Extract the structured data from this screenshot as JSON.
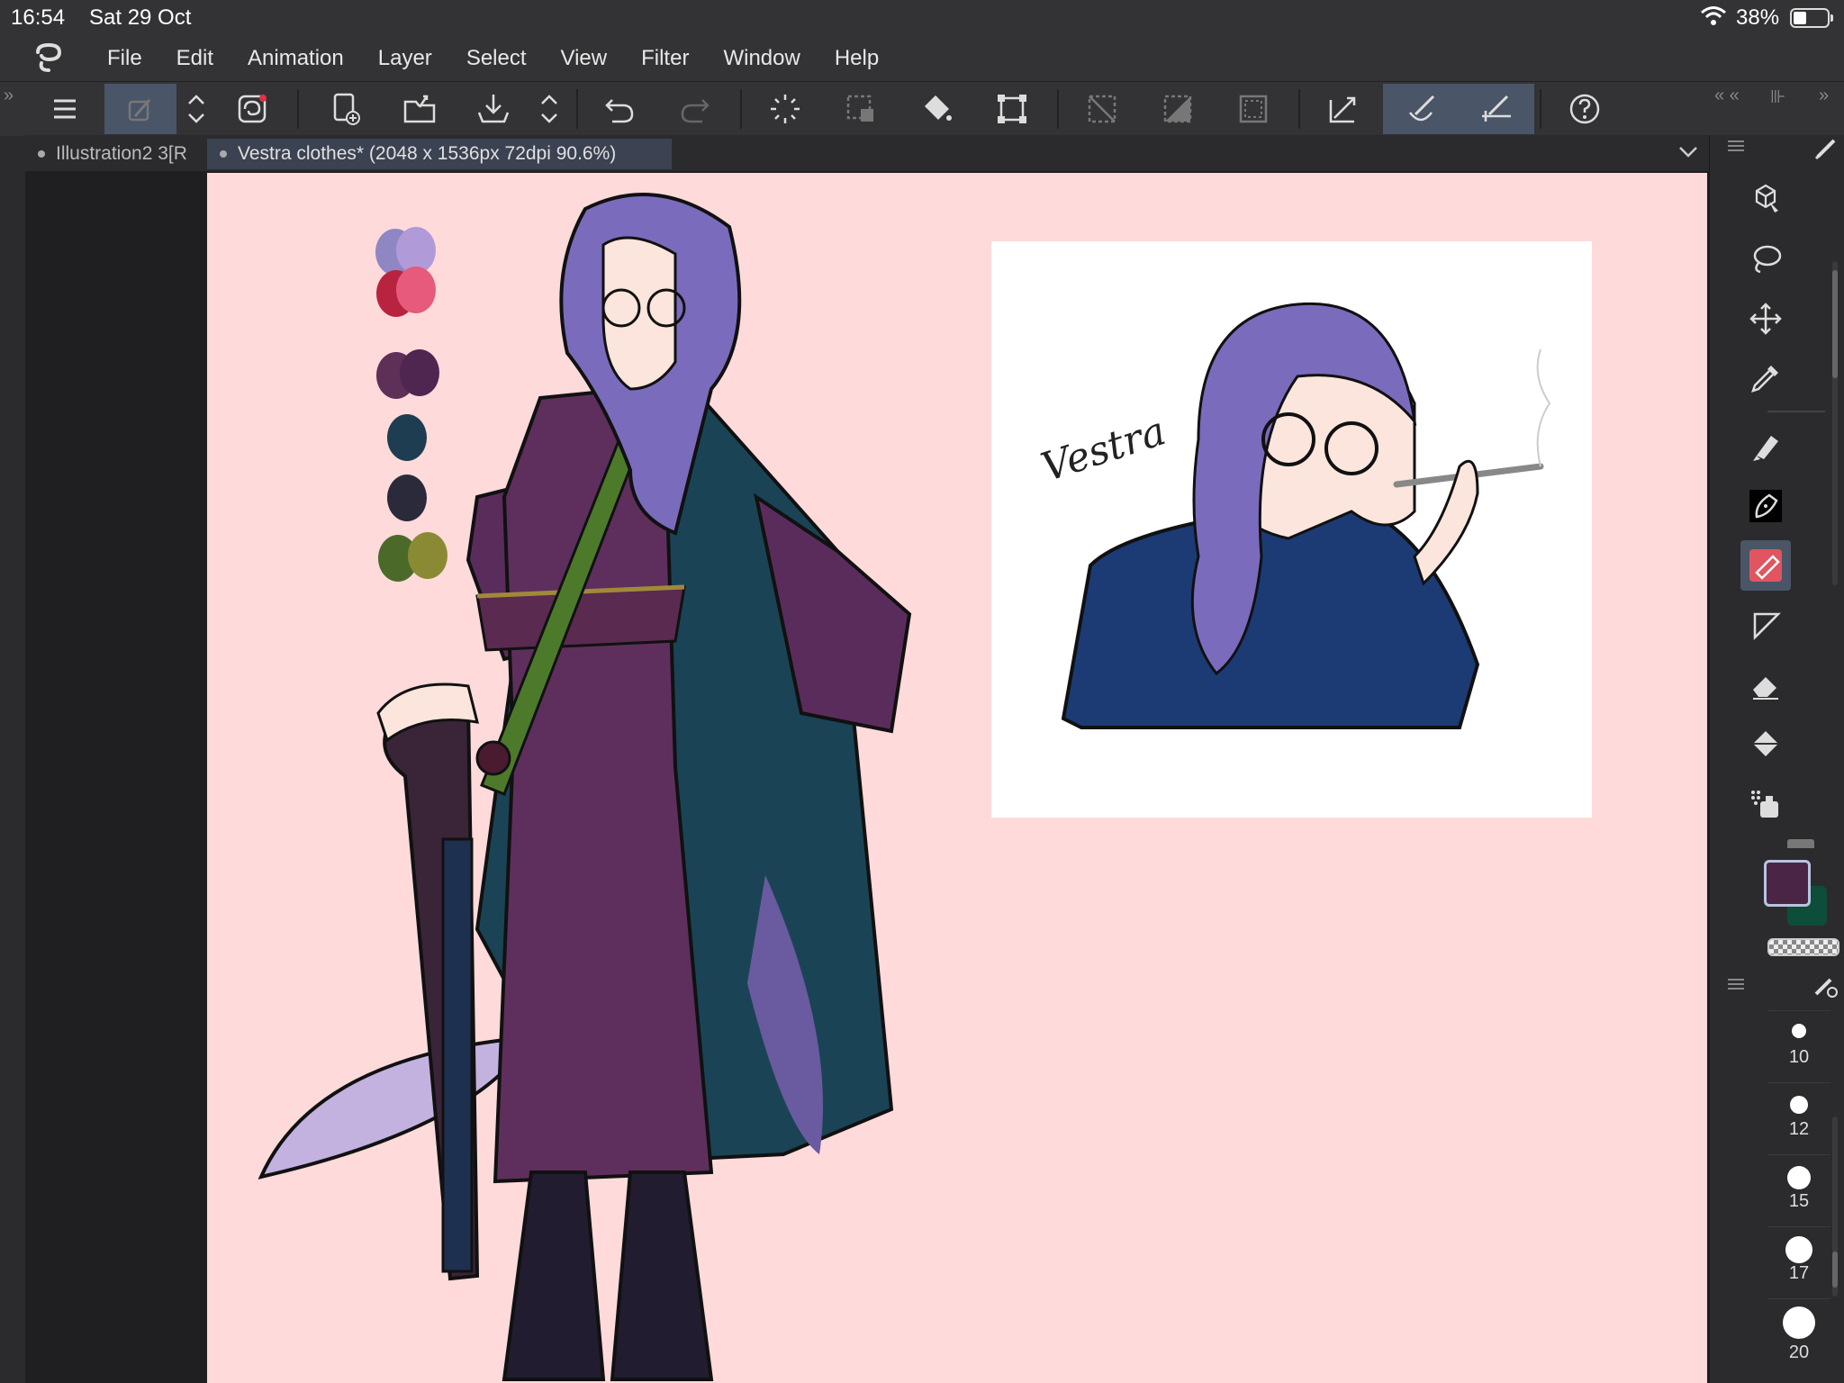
{
  "status_bar": {
    "time": "16:54",
    "date": "Sat 29 Oct",
    "battery_text": "38%"
  },
  "menu": {
    "items": [
      "File",
      "Edit",
      "Animation",
      "Layer",
      "Select",
      "View",
      "Filter",
      "Window",
      "Help"
    ]
  },
  "toolbar": {
    "icons": [
      "hamburger-menu-icon",
      "quick-access-icon",
      "up-down-chevron-icon",
      "app-logo-icon",
      "new-canvas-icon",
      "open-folder-icon",
      "save-icon",
      "up-down-chevron-icon",
      "undo-icon",
      "redo-icon",
      "auto-select-icon",
      "transform-select-icon",
      "fill-icon",
      "transform-icon",
      "deselect-icon",
      "invert-selection-icon",
      "selection-border-icon",
      "select-layer-icon",
      "stabilizer-icon",
      "snap-icon",
      "help-icon"
    ]
  },
  "tabs": [
    {
      "label": "Illustration2 3[R"
    },
    {
      "label": "Vestra clothes* (2048 x 1536px 72dpi 90.6%)"
    }
  ],
  "artwork": {
    "signature": "Vestra",
    "palette": [
      "#8f86c4",
      "#b19ad8",
      "#b8243f",
      "#e65a7b",
      "#5e2f57",
      "#4f2650",
      "#1f3d50",
      "#2b2a3a",
      "#4b6a2a",
      "#8a8a35"
    ]
  },
  "colors": {
    "main": "#4a2545",
    "sub": "#0d4d3a",
    "canvas_bg": "#fedadb",
    "accent": "#4a5568"
  },
  "right_panel": {
    "tools": [
      "3d-tool-icon",
      "lasso-icon",
      "move-icon",
      "eyedropper-icon",
      "marker-icon",
      "pen-icon",
      "eraser-active-icon",
      "ruler-icon",
      "soft-eraser-icon",
      "fill-bucket-icon",
      "airbrush-icon"
    ],
    "brush_sizes": [
      "10",
      "12",
      "15",
      "17",
      "20"
    ]
  }
}
